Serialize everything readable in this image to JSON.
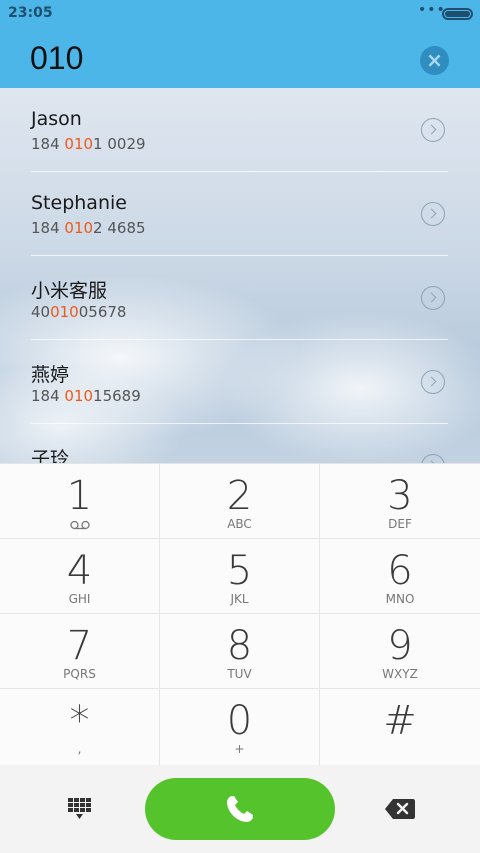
{
  "status_bar": {
    "time": "23:05",
    "more": "•••"
  },
  "dialer": {
    "input_value": "010",
    "clear_label": "×"
  },
  "contacts": [
    {
      "name": "Jason",
      "num_pre": "184 ",
      "num_match": "010",
      "num_post": "1 0029"
    },
    {
      "name": "Stephanie",
      "num_pre": "184 ",
      "num_match": "010",
      "num_post": "2 4685"
    },
    {
      "name": "小米客服",
      "num_pre": "40",
      "num_match": "010",
      "num_post": "05678"
    },
    {
      "name": "燕婷",
      "num_pre": "184 ",
      "num_match": "010",
      "num_post": "15689"
    },
    {
      "name": "子玲",
      "num_pre": "",
      "num_match": "",
      "num_post": ""
    }
  ],
  "keypad": [
    {
      "digit": "1",
      "letters": ""
    },
    {
      "digit": "2",
      "letters": "ABC"
    },
    {
      "digit": "3",
      "letters": "DEF"
    },
    {
      "digit": "4",
      "letters": "GHI"
    },
    {
      "digit": "5",
      "letters": "JKL"
    },
    {
      "digit": "6",
      "letters": "MNO"
    },
    {
      "digit": "7",
      "letters": "PQRS"
    },
    {
      "digit": "8",
      "letters": "TUV"
    },
    {
      "digit": "9",
      "letters": "WXYZ"
    },
    {
      "digit": "*",
      "letters": ","
    },
    {
      "digit": "0",
      "letters": "+"
    },
    {
      "digit": "#",
      "letters": ""
    }
  ],
  "icons": {
    "voicemail": "voicemail-icon",
    "call": "phone-icon",
    "dialpad": "dialpad-icon",
    "backspace": "backspace-icon"
  },
  "colors": {
    "header": "#4db6e8",
    "highlight": "#ee5a1a",
    "call_button": "#55c42c"
  }
}
